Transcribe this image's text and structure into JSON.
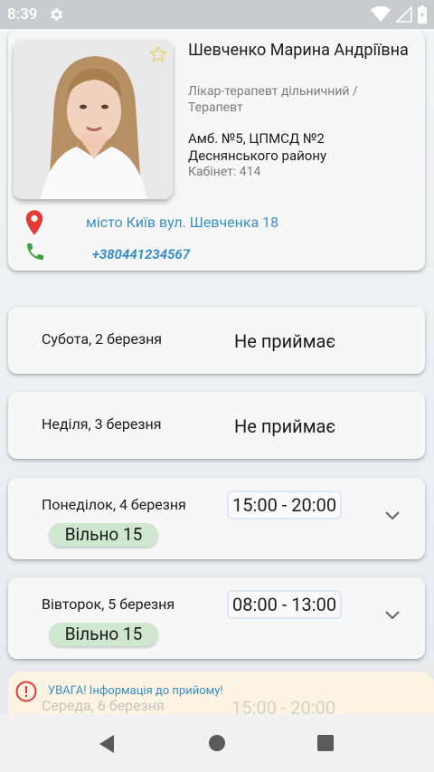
{
  "status_bar": {
    "time": "8:39"
  },
  "doctor": {
    "name": "Шевченко Марина Андріївна",
    "specialty": "Лікар-терапевт дільничний / Терапевт",
    "clinic": "Амб. №5, ЦПМСД №2 Деснянського району",
    "cabinet": "Кабінет: 414",
    "address": "місто Київ вул. Шевченка 18",
    "phone": "+380441234567"
  },
  "days": [
    {
      "label": "Субота, 2 березня",
      "status": "Не приймає"
    },
    {
      "label": "Неділя, 3 березня",
      "status": "Не приймає"
    },
    {
      "label": "Понеділок, 4 березня",
      "time": "15:00 - 20:00",
      "free": "Вільно 15"
    },
    {
      "label": "Вівторок, 5 березня",
      "time": "08:00 - 13:00",
      "free": "Вільно 15"
    },
    {
      "label": "Середа, 6 березня",
      "time": "15:00 - 20:00"
    }
  ],
  "warning": {
    "text": "УВАГА! Інформація до прийому!"
  },
  "colors": {
    "accent": "#3a8fc9",
    "pin": "#e53935",
    "phone_icon": "#43a047",
    "free_badge": "#cfe6cf"
  }
}
